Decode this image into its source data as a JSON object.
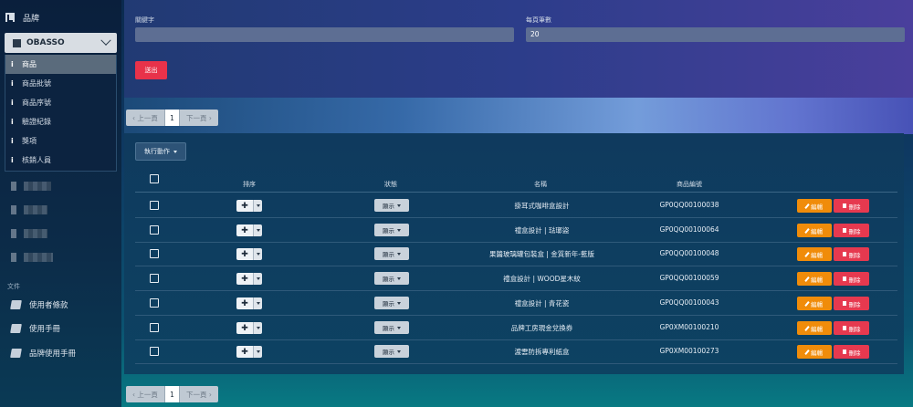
{
  "sidebar": {
    "brand_label": "品牌",
    "store_name": "OBASSO",
    "submenu": [
      {
        "label": "商品",
        "active": true
      },
      {
        "label": "商品批號",
        "active": false
      },
      {
        "label": "商品序號",
        "active": false
      },
      {
        "label": "驗證紀錄",
        "active": false
      },
      {
        "label": "獎項",
        "active": false
      },
      {
        "label": "核銷人員",
        "active": false
      }
    ],
    "docs_section": "文件",
    "docs": [
      {
        "label": "使用者條款",
        "icon": "book-icon"
      },
      {
        "label": "使用手冊",
        "icon": "book-icon"
      },
      {
        "label": "品牌使用手冊",
        "icon": "book-icon"
      }
    ]
  },
  "filter": {
    "keyword_label": "關鍵字",
    "keyword_value": "",
    "per_page_label": "每頁筆數",
    "per_page_value": "20",
    "submit_label": "送出"
  },
  "pager": {
    "prev": "‹ 上一頁",
    "current": "1",
    "next": "下一頁 ›"
  },
  "table": {
    "bulk_action": "執行動作",
    "headers": {
      "sort": "排序",
      "status": "狀態",
      "name": "名稱",
      "code": "商品編號"
    },
    "edit_label": "編輯",
    "delete_label": "刪除",
    "rows": [
      {
        "status": "顯示",
        "name": "掛耳式咖啡盒設計",
        "code": "GP0QQ00100038"
      },
      {
        "status": "顯示",
        "name": "禮盒設計 | 琺瑯盜",
        "code": "GP0QQ00100064"
      },
      {
        "status": "顯示",
        "name": "果醬玻璃罐包裝盒 | 金質新年-藍版",
        "code": "GP0QQ00100048"
      },
      {
        "status": "顯示",
        "name": "禮盒設計 | WOOD星木紋",
        "code": "GP0QQ00100059"
      },
      {
        "status": "顯示",
        "name": "禮盒設計 | 青花瓷",
        "code": "GP0QQ00100043"
      },
      {
        "status": "顯示",
        "name": "品牌工房現金兌換券",
        "code": "GP0XM00100210"
      },
      {
        "status": "顯示",
        "name": "渡雲防拆專利紙盒",
        "code": "GP0XM00100273"
      }
    ]
  },
  "colors": {
    "submit": "#e8324a",
    "edit": "#f08c0a",
    "delete": "#e6394f"
  }
}
